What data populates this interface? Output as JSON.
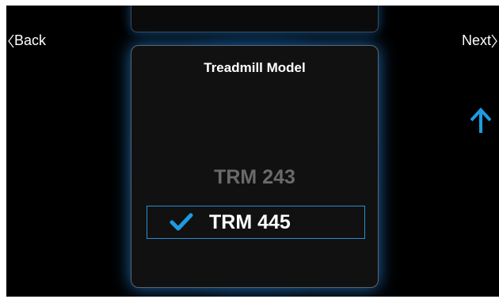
{
  "nav": {
    "back_label": "Back",
    "next_label": "Next"
  },
  "picker": {
    "title": "Treadmill Model",
    "options": [
      {
        "label": "TRM 243",
        "selected": false
      },
      {
        "label": "TRM 445",
        "selected": true
      }
    ]
  },
  "icons": {
    "back": "chevron-left-icon",
    "next": "chevron-right-icon",
    "scroll_up": "arrow-up-icon",
    "selected": "checkmark-icon"
  },
  "colors": {
    "accent": "#1e9be0",
    "glow": "#1a6fbf",
    "background": "#000000",
    "panel": "#111111",
    "dim_text": "#6a6a6a"
  }
}
